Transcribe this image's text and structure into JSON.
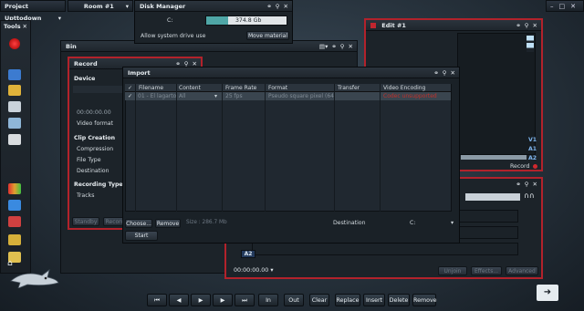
{
  "topbar": {
    "project_label": "Project Upttodown",
    "room_label": "Room #1"
  },
  "tools": {
    "title": "Tools"
  },
  "disk_manager": {
    "title": "Disk Manager",
    "drive": "C:",
    "drive_size": "374.8 Gb",
    "drive_fill_percent": 27,
    "allow_label": "Allow system drive use",
    "move_button": "Move material"
  },
  "bin": {
    "title": "Bin"
  },
  "record": {
    "title": "Record",
    "device_label": "Device",
    "timecode": "00:00:00.00",
    "video_format": "Video format",
    "clip_creation": "Clip Creation",
    "compression": "Compression",
    "file_type": "File Type",
    "destination": "Destination",
    "recording_type": "Recording Type",
    "tracks": "Tracks",
    "standby": "Standby",
    "record_btn": "Record"
  },
  "import": {
    "title": "Import",
    "columns": [
      "Filename",
      "Content",
      "Frame Rate",
      "Format",
      "Transfer",
      "Video Encoding"
    ],
    "rows": [
      {
        "filename": "01 - El lagarto",
        "content": "All",
        "frame_rate": "25 fps",
        "format": "Pseudo square pixel (640x4",
        "transfer": "",
        "encoding": "Codec unsupported"
      }
    ],
    "choose_btn": "Choose...",
    "remove_btn": "Remove",
    "size": "Size : 286.7 Mb",
    "destination_label": "Destination",
    "destination_value": "C:",
    "start_btn": "Start"
  },
  "edit": {
    "title": "Edit #1",
    "tracks": [
      "V1",
      "A1",
      "A2"
    ],
    "record_label": "Record"
  },
  "timeline": {
    "track_a2": "A2",
    "timecode": "00:00:00.00",
    "unjoin": "Unjoin",
    "effects": "Effects...",
    "advanced": "Advanced"
  },
  "transport": {
    "in": "In",
    "out": "Out",
    "clear": "Clear",
    "replace": "Replace",
    "insert": "Insert",
    "delete": "Delete",
    "remove": "Remove"
  },
  "colors": {
    "accent_red": "#b2222b",
    "accent_teal": "#4fa6a6",
    "error_red": "#c0302a"
  }
}
